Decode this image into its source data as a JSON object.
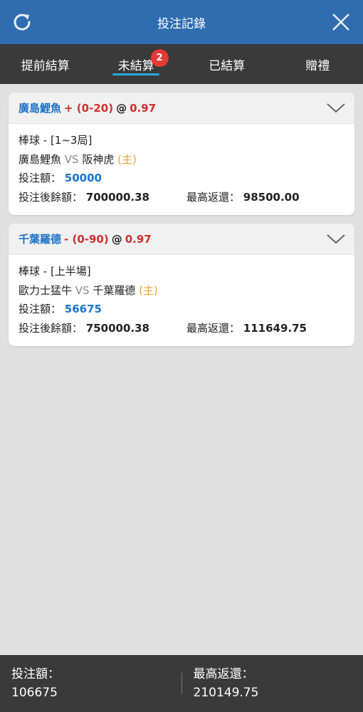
{
  "header": {
    "title": "投注記錄",
    "refresh_icon": "refresh-icon",
    "close_icon": "close-icon",
    "bg": "#2f6db0"
  },
  "tabs": [
    {
      "label": "提前結算",
      "active": false
    },
    {
      "label": "未結算",
      "active": true,
      "badge": "2"
    },
    {
      "label": "已結算",
      "active": false
    },
    {
      "label": "贈禮",
      "active": false
    }
  ],
  "bets": [
    {
      "team": "廣島鯉魚",
      "handicap": "+ (0-20)",
      "at": "@",
      "odds": "0.97",
      "sport_line": "棒球 - [1~3局]",
      "home_team": "廣島鯉魚",
      "vs": "VS",
      "away_team": "阪神虎",
      "home_mark": "(主)",
      "stake_label": "投注額：",
      "stake": "50000",
      "balance_label": "投注後餘額：",
      "balance": "700000.38",
      "max_return_label": "最高返還：",
      "max_return": "98500.00"
    },
    {
      "team": "千葉羅德",
      "handicap": "- (0-90)",
      "at": "@",
      "odds": "0.97",
      "sport_line": "棒球 - [上半場]",
      "home_team": "歐力士猛牛",
      "vs": "VS",
      "away_team": "千葉羅德",
      "home_mark": "(主)",
      "stake_label": "投注額：",
      "stake": "56675",
      "balance_label": "投注後餘額：",
      "balance": "750000.38",
      "max_return_label": "最高返還：",
      "max_return": "111649.75"
    }
  ],
  "footer": {
    "stake_label": "投注額：",
    "stake_total": "106675",
    "return_label": "最高返還：",
    "return_total": "210149.75"
  }
}
